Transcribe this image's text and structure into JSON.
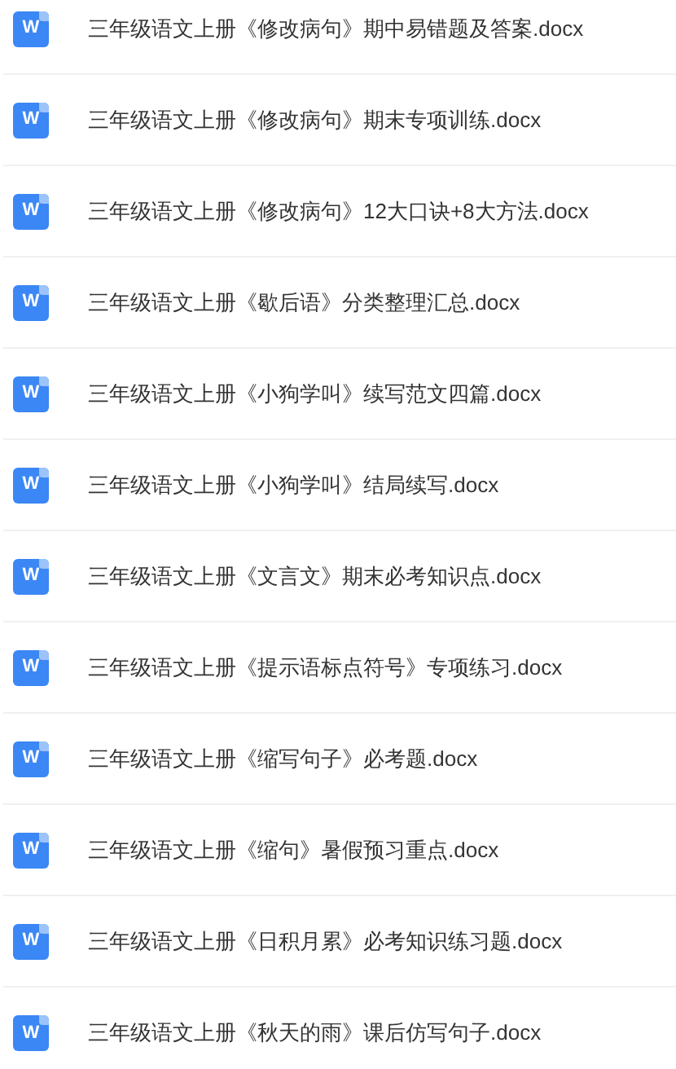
{
  "files": [
    {
      "icon_label": "W",
      "name": "三年级语文上册《修改病句》期中易错题及答案.docx"
    },
    {
      "icon_label": "W",
      "name": "三年级语文上册《修改病句》期末专项训练.docx"
    },
    {
      "icon_label": "W",
      "name": "三年级语文上册《修改病句》12大口诀+8大方法.docx"
    },
    {
      "icon_label": "W",
      "name": "三年级语文上册《歇后语》分类整理汇总.docx"
    },
    {
      "icon_label": "W",
      "name": "三年级语文上册《小狗学叫》续写范文四篇.docx"
    },
    {
      "icon_label": "W",
      "name": "三年级语文上册《小狗学叫》结局续写.docx"
    },
    {
      "icon_label": "W",
      "name": "三年级语文上册《文言文》期末必考知识点.docx"
    },
    {
      "icon_label": "W",
      "name": "三年级语文上册《提示语标点符号》专项练习.docx"
    },
    {
      "icon_label": "W",
      "name": "三年级语文上册《缩写句子》必考题.docx"
    },
    {
      "icon_label": "W",
      "name": "三年级语文上册《缩句》暑假预习重点.docx"
    },
    {
      "icon_label": "W",
      "name": "三年级语文上册《日积月累》必考知识练习题.docx"
    },
    {
      "icon_label": "W",
      "name": "三年级语文上册《秋天的雨》课后仿写句子.docx"
    }
  ]
}
